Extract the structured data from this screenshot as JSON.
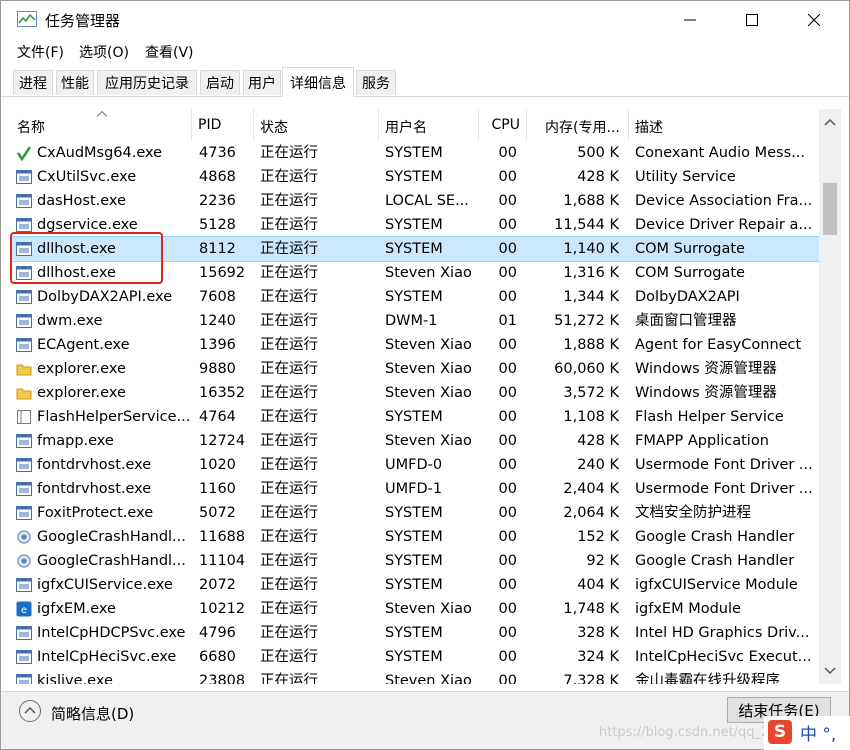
{
  "window": {
    "title": "任务管理器"
  },
  "menu": [
    "文件(F)",
    "选项(O)",
    "查看(V)"
  ],
  "tabs": [
    {
      "label": "进程"
    },
    {
      "label": "性能"
    },
    {
      "label": "应用历史记录"
    },
    {
      "label": "启动"
    },
    {
      "label": "用户"
    },
    {
      "label": "详细信息",
      "active": true
    },
    {
      "label": "服务"
    }
  ],
  "columns": [
    "名称",
    "PID",
    "状态",
    "用户名",
    "CPU",
    "内存(专用...",
    "描述"
  ],
  "rows": [
    {
      "name": "CxAudMsg64.exe",
      "pid": "4736",
      "status": "正在运行",
      "user": "SYSTEM",
      "cpu": "00",
      "mem": "500 K",
      "desc": "Conexant Audio Mess...",
      "icon": "checkmark-icon"
    },
    {
      "name": "CxUtilSvc.exe",
      "pid": "4868",
      "status": "正在运行",
      "user": "SYSTEM",
      "cpu": "00",
      "mem": "428 K",
      "desc": "Utility Service",
      "icon": "window-icon"
    },
    {
      "name": "dasHost.exe",
      "pid": "2236",
      "status": "正在运行",
      "user": "LOCAL SE...",
      "cpu": "00",
      "mem": "1,688 K",
      "desc": "Device Association Fra...",
      "icon": "window-icon"
    },
    {
      "name": "dgservice.exe",
      "pid": "5128",
      "status": "正在运行",
      "user": "SYSTEM",
      "cpu": "00",
      "mem": "11,544 K",
      "desc": "Device Driver Repair a...",
      "icon": "window-icon"
    },
    {
      "name": "dllhost.exe",
      "pid": "8112",
      "status": "正在运行",
      "user": "SYSTEM",
      "cpu": "00",
      "mem": "1,140 K",
      "desc": "COM Surrogate",
      "icon": "window-icon",
      "selected": true
    },
    {
      "name": "dllhost.exe",
      "pid": "15692",
      "status": "正在运行",
      "user": "Steven Xiao",
      "cpu": "00",
      "mem": "1,316 K",
      "desc": "COM Surrogate",
      "icon": "window-icon"
    },
    {
      "name": "DolbyDAX2API.exe",
      "pid": "7608",
      "status": "正在运行",
      "user": "SYSTEM",
      "cpu": "00",
      "mem": "1,344 K",
      "desc": "DolbyDAX2API",
      "icon": "window-icon"
    },
    {
      "name": "dwm.exe",
      "pid": "1240",
      "status": "正在运行",
      "user": "DWM-1",
      "cpu": "01",
      "mem": "51,272 K",
      "desc": "桌面窗口管理器",
      "icon": "window-icon"
    },
    {
      "name": "ECAgent.exe",
      "pid": "1396",
      "status": "正在运行",
      "user": "Steven Xiao",
      "cpu": "00",
      "mem": "1,888 K",
      "desc": "Agent for EasyConnect",
      "icon": "window-icon"
    },
    {
      "name": "explorer.exe",
      "pid": "9880",
      "status": "正在运行",
      "user": "Steven Xiao",
      "cpu": "00",
      "mem": "60,060 K",
      "desc": "Windows 资源管理器",
      "icon": "folder-icon"
    },
    {
      "name": "explorer.exe",
      "pid": "16352",
      "status": "正在运行",
      "user": "Steven Xiao",
      "cpu": "00",
      "mem": "3,572 K",
      "desc": "Windows 资源管理器",
      "icon": "folder-icon"
    },
    {
      "name": "FlashHelperService...",
      "pid": "4764",
      "status": "正在运行",
      "user": "SYSTEM",
      "cpu": "00",
      "mem": "1,108 K",
      "desc": "Flash Helper Service",
      "icon": "service-icon"
    },
    {
      "name": "fmapp.exe",
      "pid": "12724",
      "status": "正在运行",
      "user": "Steven Xiao",
      "cpu": "00",
      "mem": "428 K",
      "desc": "FMAPP Application",
      "icon": "window-icon"
    },
    {
      "name": "fontdrvhost.exe",
      "pid": "1020",
      "status": "正在运行",
      "user": "UMFD-0",
      "cpu": "00",
      "mem": "240 K",
      "desc": "Usermode Font Driver ...",
      "icon": "window-icon"
    },
    {
      "name": "fontdrvhost.exe",
      "pid": "1160",
      "status": "正在运行",
      "user": "UMFD-1",
      "cpu": "00",
      "mem": "2,404 K",
      "desc": "Usermode Font Driver ...",
      "icon": "window-icon"
    },
    {
      "name": "FoxitProtect.exe",
      "pid": "5072",
      "status": "正在运行",
      "user": "SYSTEM",
      "cpu": "00",
      "mem": "2,064 K",
      "desc": "文档安全防护进程",
      "icon": "window-icon"
    },
    {
      "name": "GoogleCrashHandl...",
      "pid": "11688",
      "status": "正在运行",
      "user": "SYSTEM",
      "cpu": "00",
      "mem": "152 K",
      "desc": "Google Crash Handler",
      "icon": "gear-icon"
    },
    {
      "name": "GoogleCrashHandl...",
      "pid": "11104",
      "status": "正在运行",
      "user": "SYSTEM",
      "cpu": "00",
      "mem": "92 K",
      "desc": "Google Crash Handler",
      "icon": "gear-icon"
    },
    {
      "name": "igfxCUIService.exe",
      "pid": "2072",
      "status": "正在运行",
      "user": "SYSTEM",
      "cpu": "00",
      "mem": "404 K",
      "desc": "igfxCUIService Module",
      "icon": "window-icon"
    },
    {
      "name": "igfxEM.exe",
      "pid": "10212",
      "status": "正在运行",
      "user": "Steven Xiao",
      "cpu": "00",
      "mem": "1,748 K",
      "desc": "igfxEM Module",
      "icon": "intel-icon"
    },
    {
      "name": "IntelCpHDCPSvc.exe",
      "pid": "4796",
      "status": "正在运行",
      "user": "SYSTEM",
      "cpu": "00",
      "mem": "328 K",
      "desc": "Intel HD Graphics Driv...",
      "icon": "window-icon"
    },
    {
      "name": "IntelCpHeciSvc.exe",
      "pid": "6680",
      "status": "正在运行",
      "user": "SYSTEM",
      "cpu": "00",
      "mem": "324 K",
      "desc": "IntelCpHeciSvc Execut...",
      "icon": "window-icon"
    },
    {
      "name": "kislive.exe",
      "pid": "23808",
      "status": "正在运行",
      "user": "Steven Xiao",
      "cpu": "00",
      "mem": "7,328 K",
      "desc": "金山毒霸在线升级程序",
      "icon": "window-icon"
    }
  ],
  "footer": {
    "fewer_details": "简略信息(D)",
    "end_task": "结束任务(E)"
  },
  "watermark": "https://blog.csdn.net/qq_2...",
  "ime": {
    "badge": "S",
    "text": "中 °,"
  }
}
